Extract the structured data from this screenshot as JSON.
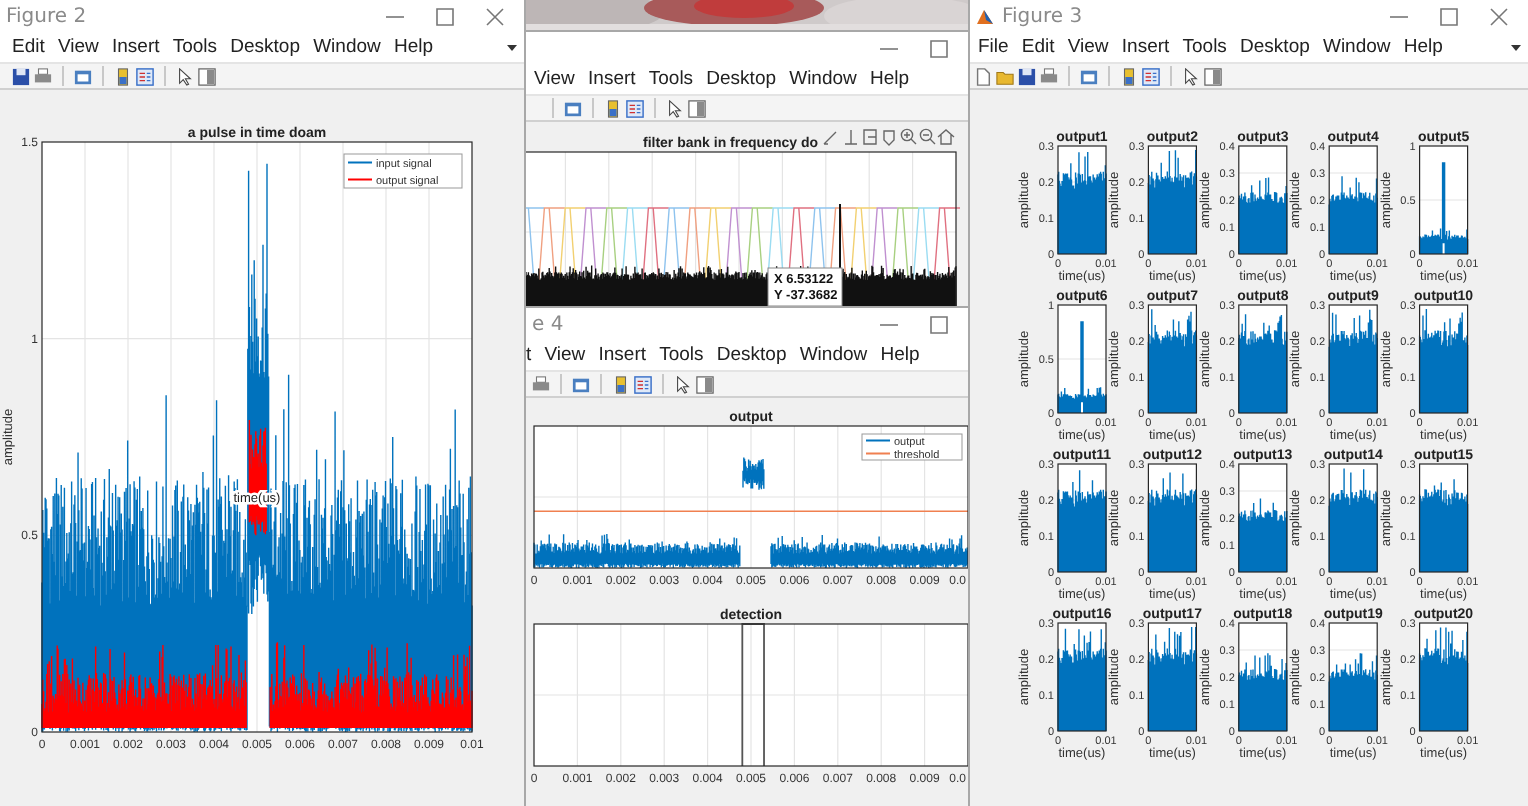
{
  "windows": [
    {
      "title": "Figure 2",
      "menu": [
        "Edit",
        "View",
        "Insert",
        "Tools",
        "Desktop",
        "Window",
        "Help"
      ],
      "axes": [
        {
          "kind": "pulse",
          "title": "a pulse in time doam",
          "ylabel": "amplitude",
          "annotation": "time(us)",
          "xticks": [
            "0",
            "0.001",
            "0.002",
            "0.003",
            "0.004",
            "0.005",
            "0.006",
            "0.007",
            "0.008",
            "0.009",
            "0.01"
          ],
          "yticks": [
            "1.5",
            "1",
            "0.5",
            "0"
          ],
          "legend": [
            {
              "label": "input signal",
              "color": "#0072bd"
            },
            {
              "label": "output signal",
              "color": "#ff0000"
            }
          ]
        }
      ]
    },
    {
      "menu": [
        "View",
        "Insert",
        "Tools",
        "Desktop",
        "Window",
        "Help"
      ],
      "axes": [
        {
          "kind": "filterbank",
          "title": "filter bank in frequency do",
          "datatip": [
            "X 6.53122",
            "Y -37.3682"
          ]
        }
      ]
    },
    {
      "title": "e 4",
      "menu": [
        "t",
        "View",
        "Insert",
        "Tools",
        "Desktop",
        "Window",
        "Help"
      ],
      "axes": [
        {
          "kind": "output",
          "title": "output",
          "xticks": [
            "0",
            "0.001",
            "0.002",
            "0.003",
            "0.004",
            "0.005",
            "0.006",
            "0.007",
            "0.008",
            "0.009",
            "0.0"
          ],
          "legend": [
            {
              "label": "output",
              "color": "#0072bd"
            },
            {
              "label": "threshold",
              "color": "#f08050"
            }
          ]
        },
        {
          "kind": "detection",
          "title": "detection",
          "xticks": [
            "0",
            "0.001",
            "0.002",
            "0.003",
            "0.004",
            "0.005",
            "0.006",
            "0.007",
            "0.008",
            "0.009",
            "0.0"
          ]
        }
      ]
    },
    {
      "title": "Figure 3",
      "menu": [
        "File",
        "Edit",
        "View",
        "Insert",
        "Tools",
        "Desktop",
        "Window",
        "Help"
      ],
      "axes": [
        {
          "kind": "noise",
          "title": "output1",
          "ylabel": "amplitude",
          "xlabel": "time(us)",
          "xticks": [
            "0",
            "0.01"
          ],
          "yticks": [
            "0.3",
            "0.2",
            "0.1",
            "0"
          ]
        },
        {
          "kind": "noise",
          "title": "output2",
          "ylabel": "amplitude",
          "xlabel": "time(us)",
          "xticks": [
            "0",
            "0.01"
          ],
          "yticks": [
            "0.3",
            "0.2",
            "0.1",
            "0"
          ]
        },
        {
          "kind": "noise",
          "title": "output3",
          "ylabel": "amplitude",
          "xlabel": "time(us)",
          "xticks": [
            "0",
            "0.01"
          ],
          "yticks": [
            "0.4",
            "0.3",
            "0.2",
            "0.1",
            "0"
          ]
        },
        {
          "kind": "noise",
          "title": "output4",
          "ylabel": "amplitude",
          "xlabel": "time(us)",
          "xticks": [
            "0",
            "0.01"
          ],
          "yticks": [
            "0.4",
            "0.3",
            "0.2",
            "0.1",
            "0"
          ]
        },
        {
          "kind": "spike",
          "title": "output5",
          "ylabel": "amplitude",
          "xlabel": "time(us)",
          "xticks": [
            "0",
            "0.01"
          ],
          "yticks": [
            "1",
            "0.5",
            "0"
          ]
        },
        {
          "kind": "spike",
          "title": "output6",
          "ylabel": "amplitude",
          "xlabel": "time(us)",
          "xticks": [
            "0",
            "0.01"
          ],
          "yticks": [
            "1",
            "0.5",
            "0"
          ]
        },
        {
          "kind": "noise",
          "title": "output7",
          "ylabel": "amplitude",
          "xlabel": "time(us)",
          "xticks": [
            "0",
            "0.01"
          ],
          "yticks": [
            "0.3",
            "0.2",
            "0.1",
            "0"
          ]
        },
        {
          "kind": "noise",
          "title": "output8",
          "ylabel": "amplitude",
          "xlabel": "time(us)",
          "xticks": [
            "0",
            "0.01"
          ],
          "yticks": [
            "0.3",
            "0.2",
            "0.1",
            "0"
          ]
        },
        {
          "kind": "noise",
          "title": "output9",
          "ylabel": "amplitude",
          "xlabel": "time(us)",
          "xticks": [
            "0",
            "0.01"
          ],
          "yticks": [
            "0.3",
            "0.2",
            "0.1",
            "0"
          ]
        },
        {
          "kind": "noise",
          "title": "output10",
          "ylabel": "amplitude",
          "xlabel": "time(us)",
          "xticks": [
            "0",
            "0.01"
          ],
          "yticks": [
            "0.3",
            "0.2",
            "0.1",
            "0"
          ]
        },
        {
          "kind": "noise",
          "title": "output11",
          "ylabel": "amplitude",
          "xlabel": "time(us)",
          "xticks": [
            "0",
            "0.01"
          ],
          "yticks": [
            "0.3",
            "0.2",
            "0.1",
            "0"
          ]
        },
        {
          "kind": "noise",
          "title": "output12",
          "ylabel": "amplitude",
          "xlabel": "time(us)",
          "xticks": [
            "0",
            "0.01"
          ],
          "yticks": [
            "0.3",
            "0.2",
            "0.1",
            "0"
          ]
        },
        {
          "kind": "noise",
          "title": "output13",
          "ylabel": "amplitude",
          "xlabel": "time(us)",
          "xticks": [
            "0",
            "0.01"
          ],
          "yticks": [
            "0.4",
            "0.3",
            "0.2",
            "0.1",
            "0"
          ]
        },
        {
          "kind": "noise",
          "title": "output14",
          "ylabel": "amplitude",
          "xlabel": "time(us)",
          "xticks": [
            "0",
            "0.01"
          ],
          "yticks": [
            "0.3",
            "0.2",
            "0.1",
            "0"
          ]
        },
        {
          "kind": "noise",
          "title": "output15",
          "ylabel": "amplitude",
          "xlabel": "time(us)",
          "xticks": [
            "0",
            "0.01"
          ],
          "yticks": [
            "0.3",
            "0.2",
            "0.1",
            "0"
          ]
        },
        {
          "kind": "noise",
          "title": "output16",
          "ylabel": "amplitude",
          "xlabel": "time(us)",
          "xticks": [
            "0",
            "0.01"
          ],
          "yticks": [
            "0.3",
            "0.2",
            "0.1",
            "0"
          ]
        },
        {
          "kind": "noise",
          "title": "output17",
          "ylabel": "amplitude",
          "xlabel": "time(us)",
          "xticks": [
            "0",
            "0.01"
          ],
          "yticks": [
            "0.3",
            "0.2",
            "0.1",
            "0"
          ]
        },
        {
          "kind": "noise",
          "title": "output18",
          "ylabel": "amplitude",
          "xlabel": "time(us)",
          "xticks": [
            "0",
            "0.01"
          ],
          "yticks": [
            "0.4",
            "0.3",
            "0.2",
            "0.1",
            "0"
          ]
        },
        {
          "kind": "noise",
          "title": "output19",
          "ylabel": "amplitude",
          "xlabel": "time(us)",
          "xticks": [
            "0",
            "0.01"
          ],
          "yticks": [
            "0.4",
            "0.3",
            "0.2",
            "0.1",
            "0"
          ]
        },
        {
          "kind": "noise",
          "title": "output20",
          "ylabel": "amplitude",
          "xlabel": "time(us)",
          "xticks": [
            "0",
            "0.01"
          ],
          "yticks": [
            "0.3",
            "0.2",
            "0.1",
            "0"
          ]
        }
      ]
    }
  ]
}
